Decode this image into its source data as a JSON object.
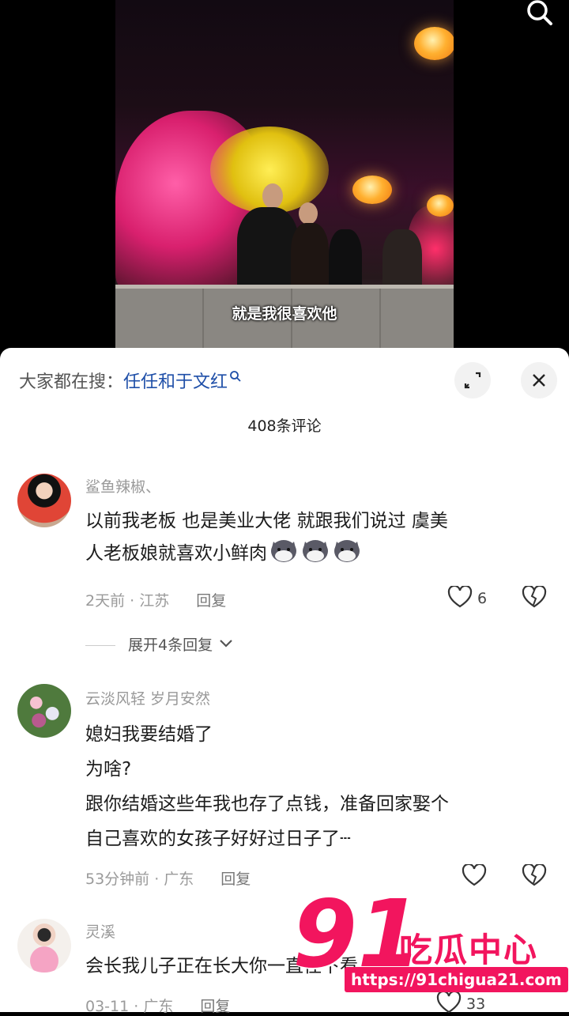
{
  "video": {
    "subtitle": "就是我很喜欢他",
    "search_icon": "search-icon"
  },
  "header": {
    "suggest_label": "大家都在搜：",
    "suggest_query": "任任和于文红",
    "count": "408条评论",
    "expand_icon": "expand-icon",
    "close_icon": "close-icon"
  },
  "comments": [
    {
      "user": "鲨鱼辣椒、",
      "lines": [
        "以前我老板 也是美业大佬 就跟我们说过 虞美",
        "人老板娘就喜欢小鲜肉"
      ],
      "time": "2天前 · 江苏",
      "reply": "回复",
      "likes": "6",
      "expand": "展开4条回复"
    },
    {
      "user": "云淡风轻   岁月安然",
      "lines": [
        "媳妇我要结婚了",
        "为啥?",
        "跟你结婚这些年我也存了点钱，准备回家娶个",
        "自己喜欢的女孩子好好过日子了┄"
      ],
      "time": "53分钟前 · 广东",
      "reply": "回复",
      "likes": ""
    },
    {
      "user": "灵溪",
      "lines": [
        "会长我儿子正在长大你一直往下看"
      ],
      "time": "03-11 · 广东",
      "reply": "回复",
      "likes": "33"
    }
  ],
  "watermark": {
    "number": "91",
    "name": "吃瓜中心",
    "url": "https://91chigua21.com"
  }
}
